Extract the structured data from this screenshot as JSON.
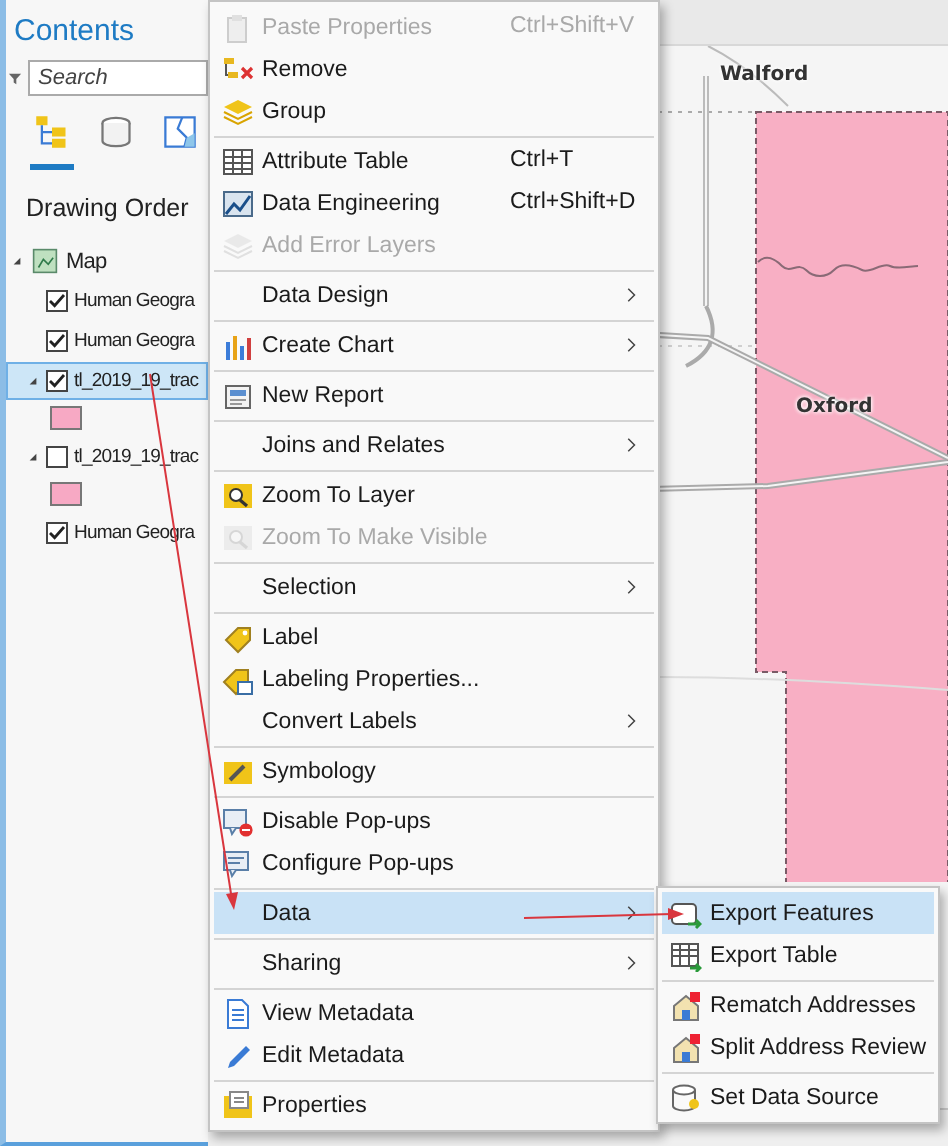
{
  "contents_pane": {
    "title": "Contents",
    "search": {
      "placeholder": "Search"
    },
    "view_tabs": [
      {
        "selected": true
      },
      {
        "selected": false
      },
      {
        "selected": false
      }
    ],
    "heading": "Drawing Order",
    "map": {
      "label": "Map",
      "expanded": true,
      "children": [
        {
          "label": "Human Geogra",
          "kind": "basemap",
          "checked": true,
          "selected": false
        },
        {
          "label": "Human Geogra",
          "kind": "basemap",
          "checked": true,
          "selected": false
        },
        {
          "label": "tl_2019_19_trac",
          "kind": "feature",
          "checked": true,
          "selected": true,
          "expanded": true
        },
        {
          "label": "tl_2019_19_trac",
          "kind": "feature",
          "checked": false,
          "selected": false,
          "expanded": true
        },
        {
          "label": "Human Geogra",
          "kind": "basemap",
          "checked": true,
          "selected": false
        }
      ]
    }
  },
  "map_view": {
    "labels": [
      "Walford",
      "Oxford"
    ]
  },
  "context_menu": {
    "groups": [
      [
        {
          "label": "Paste Properties",
          "shortcut": "Ctrl+Shift+V",
          "disabled": true,
          "submenu": false,
          "selected": false
        },
        {
          "label": "Remove",
          "disabled": false,
          "submenu": false,
          "selected": false
        },
        {
          "label": "Group",
          "disabled": false,
          "submenu": false,
          "selected": false
        }
      ],
      [
        {
          "label": "Attribute Table",
          "shortcut": "Ctrl+T",
          "disabled": false,
          "submenu": false,
          "selected": false
        },
        {
          "label": "Data Engineering",
          "shortcut": "Ctrl+Shift+D",
          "disabled": false,
          "submenu": false,
          "selected": false
        },
        {
          "label": "Add Error Layers",
          "disabled": true,
          "submenu": false,
          "selected": false
        }
      ],
      [
        {
          "label": "Data Design",
          "disabled": false,
          "submenu": true,
          "selected": false
        }
      ],
      [
        {
          "label": "Create Chart",
          "disabled": false,
          "submenu": true,
          "selected": false
        }
      ],
      [
        {
          "label": "New Report",
          "disabled": false,
          "submenu": false,
          "selected": false
        }
      ],
      [
        {
          "label": "Joins and Relates",
          "disabled": false,
          "submenu": true,
          "selected": false
        }
      ],
      [
        {
          "label": "Zoom To Layer",
          "disabled": false,
          "submenu": false,
          "selected": false
        },
        {
          "label": "Zoom To Make Visible",
          "disabled": true,
          "submenu": false,
          "selected": false
        }
      ],
      [
        {
          "label": "Selection",
          "disabled": false,
          "submenu": true,
          "selected": false
        }
      ],
      [
        {
          "label": "Label",
          "disabled": false,
          "submenu": false,
          "selected": false
        },
        {
          "label": "Labeling Properties...",
          "disabled": false,
          "submenu": false,
          "selected": false
        },
        {
          "label": "Convert Labels",
          "disabled": false,
          "submenu": true,
          "selected": false
        }
      ],
      [
        {
          "label": "Symbology",
          "disabled": false,
          "submenu": false,
          "selected": false
        }
      ],
      [
        {
          "label": "Disable Pop-ups",
          "disabled": false,
          "submenu": false,
          "selected": false
        },
        {
          "label": "Configure Pop-ups",
          "disabled": false,
          "submenu": false,
          "selected": false
        }
      ],
      [
        {
          "label": "Data",
          "disabled": false,
          "submenu": true,
          "selected": true
        }
      ],
      [
        {
          "label": "Sharing",
          "disabled": false,
          "submenu": true,
          "selected": false
        }
      ],
      [
        {
          "label": "View Metadata",
          "disabled": false,
          "submenu": false,
          "selected": false
        },
        {
          "label": "Edit Metadata",
          "disabled": false,
          "submenu": false,
          "selected": false
        }
      ],
      [
        {
          "label": "Properties",
          "disabled": false,
          "submenu": false,
          "selected": false
        }
      ]
    ]
  },
  "data_submenu": {
    "groups": [
      [
        {
          "label": "Export Features",
          "disabled": false,
          "submenu": false,
          "selected": true
        },
        {
          "label": "Export Table",
          "disabled": false,
          "submenu": false,
          "selected": false
        }
      ],
      [
        {
          "label": "Rematch Addresses",
          "disabled": false,
          "submenu": false,
          "selected": false
        },
        {
          "label": "Split Address Review",
          "disabled": false,
          "submenu": false,
          "selected": false
        }
      ],
      [
        {
          "label": "Set Data Source",
          "disabled": false,
          "submenu": false,
          "selected": false
        }
      ]
    ]
  }
}
